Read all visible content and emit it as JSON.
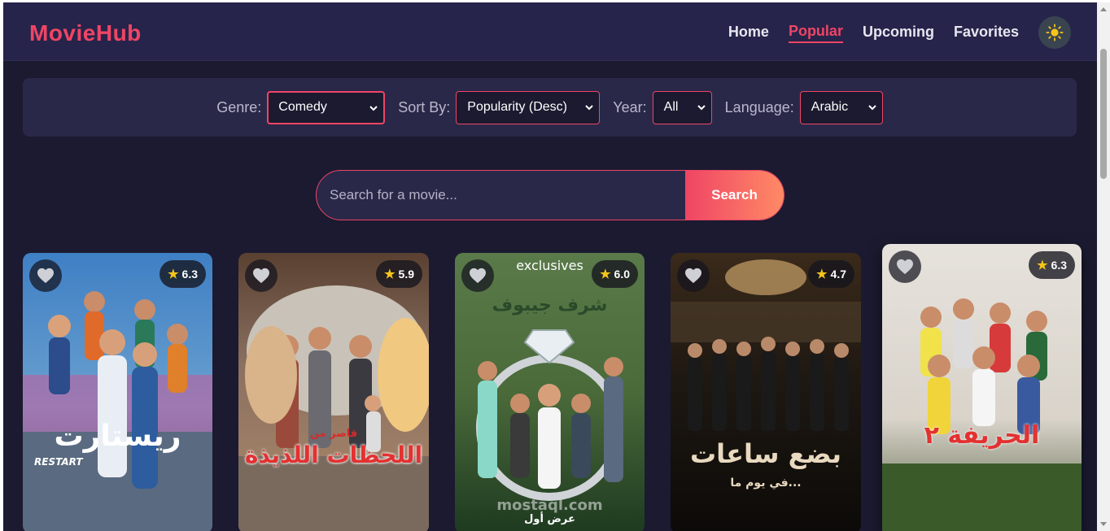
{
  "app": {
    "logo": "MovieHub",
    "nav": [
      {
        "label": "Home",
        "active": false
      },
      {
        "label": "Popular",
        "active": true
      },
      {
        "label": "Upcoming",
        "active": false
      },
      {
        "label": "Favorites",
        "active": false
      }
    ],
    "theme_icon": "sun-icon"
  },
  "filters": {
    "genre": {
      "label": "Genre:",
      "value": "Comedy"
    },
    "sort": {
      "label": "Sort By:",
      "value": "Popularity (Desc)"
    },
    "year": {
      "label": "Year:",
      "value": "All"
    },
    "language": {
      "label": "Language:",
      "value": "Arabic"
    }
  },
  "search": {
    "placeholder": "Search for a movie...",
    "button": "Search"
  },
  "movies": [
    {
      "rating": "6.3",
      "title_text": "ريستارت",
      "subtitle_text": "RESTART"
    },
    {
      "rating": "5.9",
      "title_text": "اللحظات اللذيذة",
      "subtitle_text": "قاصر من"
    },
    {
      "rating": "6.0",
      "title_text": "شرف جيبوف",
      "top_text": "exclusives",
      "footer_text": "عرض أول",
      "watermark": "mostaql.com"
    },
    {
      "rating": "4.7",
      "title_text": "بضع ساعات",
      "subtitle_text": "في يوم ما..."
    },
    {
      "rating": "6.3",
      "title_text": "الحريفة ٢"
    }
  ],
  "colors": {
    "accent": "#ef4565",
    "background": "#1b1a30",
    "navbar": "#26244a",
    "panel": "#2a2848"
  }
}
